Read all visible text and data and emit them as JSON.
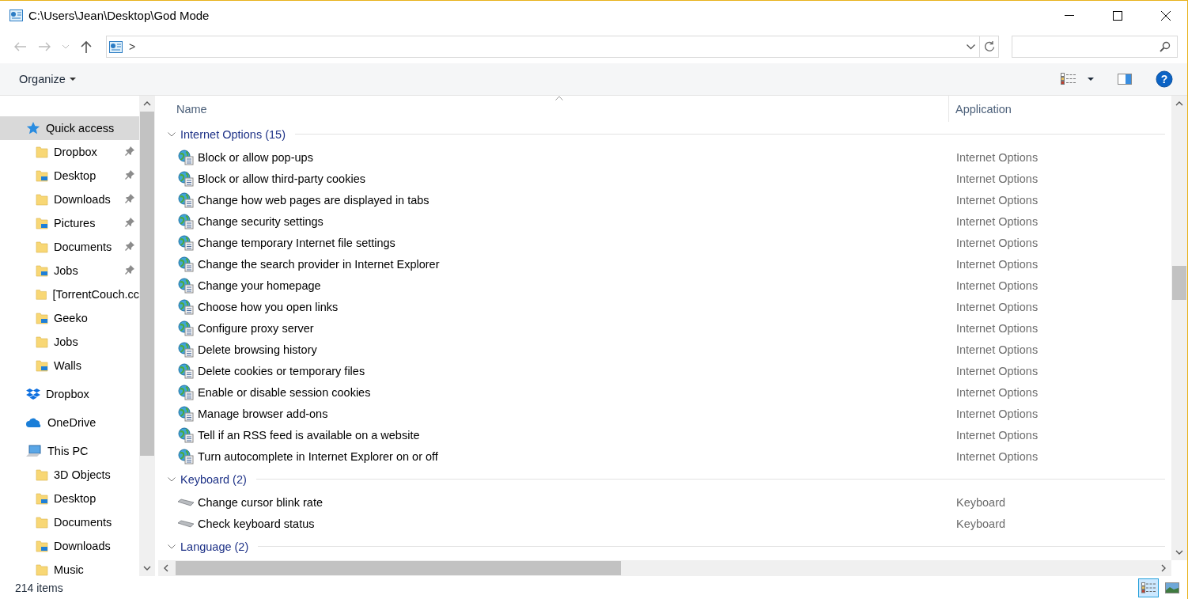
{
  "window": {
    "title": "C:\\Users\\Jean\\Desktop\\God Mode"
  },
  "address": {
    "separator": ">"
  },
  "toolbar": {
    "organize": "Organize",
    "help": "?"
  },
  "sidebar": {
    "items": [
      {
        "label": "Quick access",
        "kind": "quick_access",
        "selected": true,
        "children": [
          {
            "label": "Dropbox",
            "pinned": true
          },
          {
            "label": "Desktop",
            "pinned": true
          },
          {
            "label": "Downloads",
            "pinned": true
          },
          {
            "label": "Pictures",
            "pinned": true
          },
          {
            "label": "Documents",
            "pinned": true
          },
          {
            "label": "Jobs",
            "pinned": true
          },
          {
            "label": "[TorrentCouch.cc",
            "pinned": false
          },
          {
            "label": "Geeko",
            "pinned": false
          },
          {
            "label": "Jobs",
            "pinned": false
          },
          {
            "label": "Walls",
            "pinned": false
          }
        ]
      },
      {
        "label": "Dropbox",
        "kind": "dropbox",
        "selected": false
      },
      {
        "label": "OneDrive",
        "kind": "onedrive",
        "selected": false
      },
      {
        "label": "This PC",
        "kind": "this_pc",
        "selected": false,
        "children": [
          {
            "label": "3D Objects",
            "pinned": false
          },
          {
            "label": "Desktop",
            "pinned": false
          },
          {
            "label": "Documents",
            "pinned": false
          },
          {
            "label": "Downloads",
            "pinned": false
          },
          {
            "label": "Music",
            "pinned": false
          }
        ]
      }
    ]
  },
  "table": {
    "columns": [
      "Name",
      "Application"
    ],
    "groups": [
      {
        "title": "Internet Options (15)",
        "kind": "internet",
        "expanded": true,
        "rows": [
          {
            "name": "Block or allow pop-ups",
            "application": "Internet Options"
          },
          {
            "name": "Block or allow third-party cookies",
            "application": "Internet Options"
          },
          {
            "name": "Change how web pages are displayed in tabs",
            "application": "Internet Options"
          },
          {
            "name": "Change security settings",
            "application": "Internet Options"
          },
          {
            "name": "Change temporary Internet file settings",
            "application": "Internet Options"
          },
          {
            "name": "Change the search provider in Internet Explorer",
            "application": "Internet Options"
          },
          {
            "name": "Change your homepage",
            "application": "Internet Options"
          },
          {
            "name": "Choose how you open links",
            "application": "Internet Options"
          },
          {
            "name": "Configure proxy server",
            "application": "Internet Options"
          },
          {
            "name": "Delete browsing history",
            "application": "Internet Options"
          },
          {
            "name": "Delete cookies or temporary files",
            "application": "Internet Options"
          },
          {
            "name": "Enable or disable session cookies",
            "application": "Internet Options"
          },
          {
            "name": "Manage browser add-ons",
            "application": "Internet Options"
          },
          {
            "name": "Tell if an RSS feed is available on a website",
            "application": "Internet Options"
          },
          {
            "name": "Turn autocomplete in Internet Explorer on or off",
            "application": "Internet Options"
          }
        ]
      },
      {
        "title": "Keyboard (2)",
        "kind": "keyboard",
        "expanded": true,
        "rows": [
          {
            "name": "Change cursor blink rate",
            "application": "Keyboard"
          },
          {
            "name": "Check keyboard status",
            "application": "Keyboard"
          }
        ]
      },
      {
        "title": "Language (2)",
        "expanded": true
      }
    ]
  },
  "status_bar": {
    "count": "214 items",
    "views": [
      {
        "selected": true
      },
      {
        "selected": false
      }
    ]
  }
}
